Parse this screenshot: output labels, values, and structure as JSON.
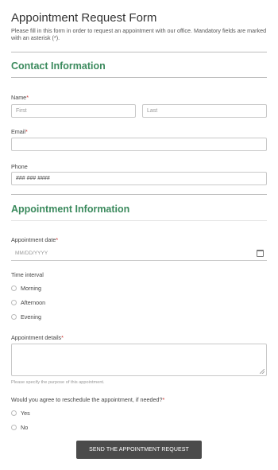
{
  "form": {
    "title": "Appointment Request Form",
    "description": "Please fill in this form in order to request an appointment with our office. Mandatory fields are marked with an asterisk (*)."
  },
  "contact": {
    "section_title": "Contact Information",
    "name_label": "Name",
    "first_placeholder": "First",
    "last_placeholder": "Last",
    "email_label": "Email",
    "phone_label": "Phone",
    "phone_placeholder": "### ### ####"
  },
  "appointment": {
    "section_title": "Appointment Information",
    "date_label": "Appointment date",
    "date_placeholder": "MM/DD/YYYY",
    "time_label": "Time interval",
    "time_options": [
      "Morning",
      "Afternoon",
      "Evening"
    ],
    "details_label": "Appointment details",
    "details_hint": "Please specify the purpose of this appointment.",
    "reschedule_label": "Would you agree to reschedule the appointment, if needed?",
    "reschedule_options": [
      "Yes",
      "No"
    ]
  },
  "required_marker": "*",
  "submit_label": "SEND THE APPOINTMENT REQUEST",
  "colors": {
    "section_title": "#3b8a5d",
    "required": "#c9302c",
    "button": "#4b4b4b"
  },
  "icons": {
    "date": "calendar-icon"
  }
}
